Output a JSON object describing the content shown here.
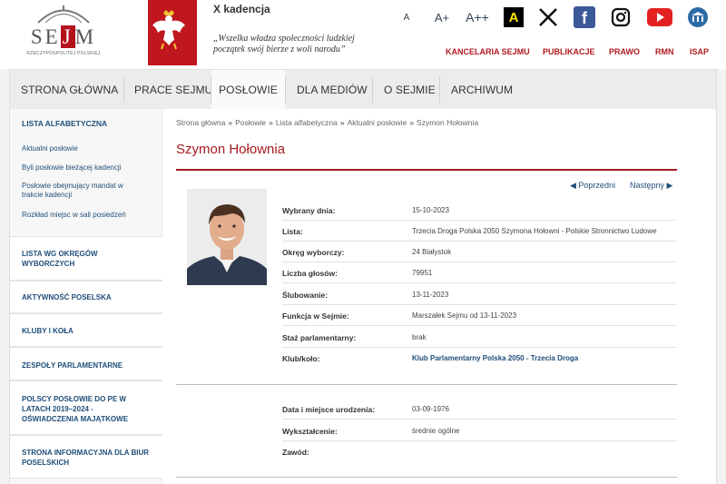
{
  "header": {
    "logo_text_a": "S",
    "logo_text_b": "E",
    "logo_text_j": "J",
    "logo_text_m": "M",
    "logo_subtitle": "RZECZYPOSPOLITEJ POLSKIEJ",
    "kadencja": "X kadencja",
    "quote": "„Wszelka władza społeczności ludzkiej początek swój bierze z woli narodu”",
    "font_small": "A",
    "font_medium": "A+",
    "font_large": "A++",
    "contrast": "A",
    "top_links": [
      "KANCELARIA SEJMU",
      "PUBLIKACJE",
      "PRAWO",
      "RMN",
      "ISAP"
    ]
  },
  "nav": {
    "items": [
      "STRONA GŁÓWNA",
      "PRACE SEJMU",
      "POSŁOWIE",
      "DLA MEDIÓW",
      "O SEJMIE",
      "ARCHIWUM"
    ],
    "active_index": 2
  },
  "sidebar": {
    "heading": "LISTA ALFABETYCZNA",
    "links": [
      "Aktualni posłowie",
      "Byli posłowie bieżącej kadencji",
      "Posłowie obejmujący mandat w trakcie kadencji",
      "Rozkład miejsc w sali posiedzeń"
    ],
    "sections": [
      "LISTA WG OKRĘGÓW WYBORCZYCH",
      "AKTYWNOŚĆ POSELSKA",
      "KLUBY I KOŁA",
      "ZESPOŁY PARLAMENTARNE",
      "POLSCY POSŁOWIE DO PE W LATACH 2019–2024 - OŚWIADCZENIA MAJĄTKOWE",
      "STRONA INFORMACYJNA DLA BIUR POSELSKICH"
    ]
  },
  "breadcrumb": [
    "Strona główna",
    "Posłowie",
    "Lista alfabetyczna",
    "Aktualni posłowie",
    "Szymon Hołownia"
  ],
  "breadcrumb_sep": "»",
  "mp": {
    "name": "Szymon Hołownia",
    "prev_label": "◀ Poprzedni",
    "next_label": "Następny ▶",
    "details": [
      {
        "label": "Wybrany dnia:",
        "value": "15-10-2023"
      },
      {
        "label": "Lista:",
        "value": "Trzecia Droga Polska 2050 Szymona Hołowni - Polskie Stronnictwo Ludowe"
      },
      {
        "label": "Okręg wyborczy:",
        "value": "24  Białystok"
      },
      {
        "label": "Liczba głosów:",
        "value": "79951"
      },
      {
        "label": "Ślubowanie:",
        "value": "13-11-2023"
      },
      {
        "label": "Funkcja w Sejmie:",
        "value": "Marszałek Sejmu od 13-11-2023"
      },
      {
        "label": "Staż parlamentarny:",
        "value": "brak"
      },
      {
        "label": "Klub/koło:",
        "value": "Klub Parlamentarny Polska 2050 - Trzecia Droga"
      }
    ],
    "personal": [
      {
        "label": "Data i miejsce urodzenia:",
        "value": "03-09-1976"
      },
      {
        "label": "Wykształcenie:",
        "value": "średnie ogólne"
      },
      {
        "label": "Zawód:",
        "value": ""
      }
    ]
  },
  "colors": {
    "accent_red": "#a31a1f",
    "link_blue": "#1f4e79"
  }
}
